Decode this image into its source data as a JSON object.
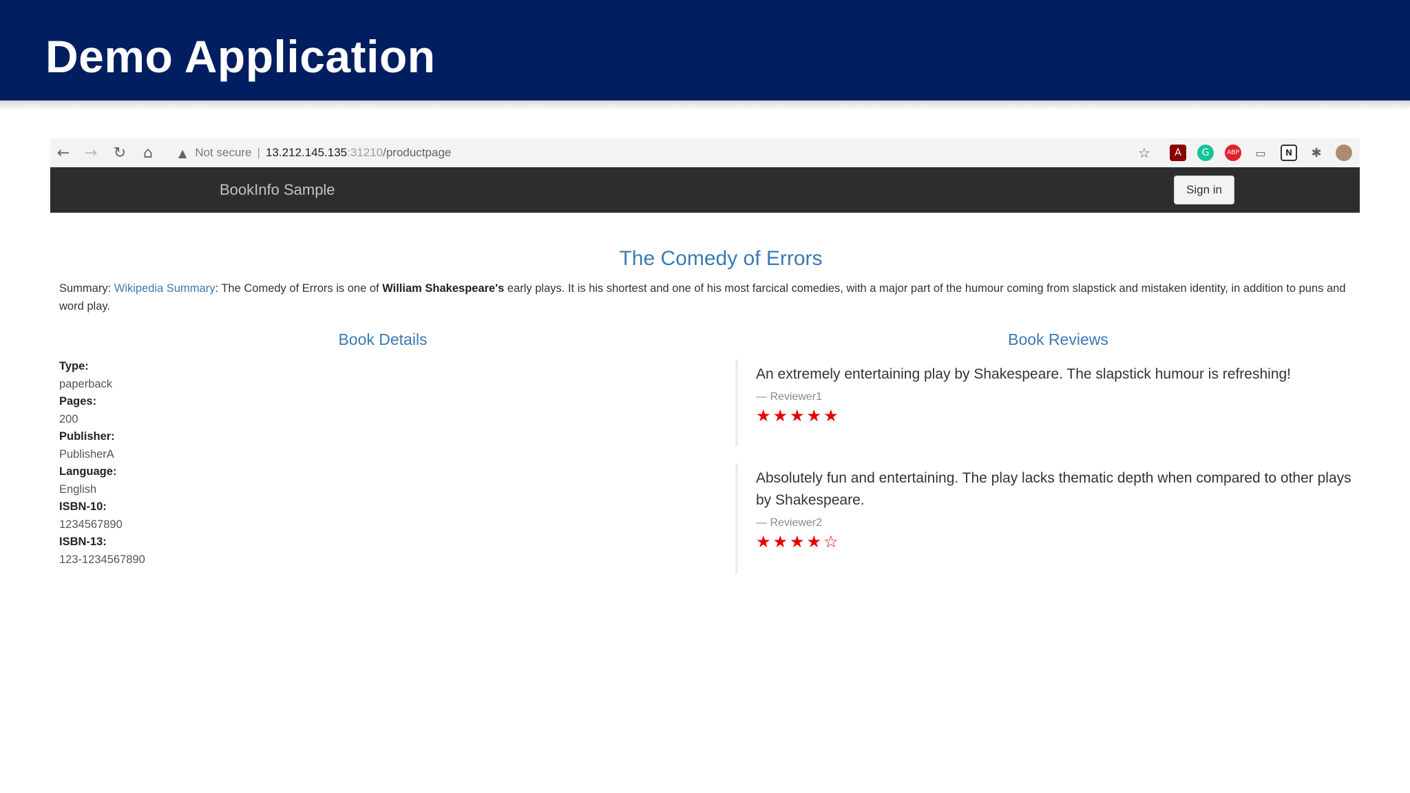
{
  "slide": {
    "title": "Demo Application"
  },
  "browser": {
    "back_icon": "arrow-left-icon",
    "forward_icon": "arrow-right-icon",
    "reload_icon": "reload-icon",
    "home_icon": "home-icon",
    "security_label": "Not secure",
    "separator": "|",
    "url_host": "13.212.145.135",
    "url_port": ":31210",
    "url_path": "/productpage",
    "extensions": [
      "bookmark-star-icon",
      "pdf-icon",
      "grammarly-icon",
      "adblock-icon",
      "cast-icon",
      "notion-icon",
      "puzzle-extensions-icon",
      "profile-avatar-icon"
    ]
  },
  "app": {
    "brand": "BookInfo Sample",
    "sign_in": "Sign in"
  },
  "product": {
    "title": "The Comedy of Errors",
    "summary_prefix": "Summary: ",
    "summary_link": "Wikipedia Summary",
    "summary_text_1": ": The Comedy of Errors is one of ",
    "summary_bold": "William Shakespeare's",
    "summary_text_2": " early plays. It is his shortest and one of his most farcical comedies, with a major part of the humour coming from slapstick and mistaken identity, in addition to puns and word play."
  },
  "details": {
    "heading": "Book Details",
    "items": [
      {
        "label": "Type:",
        "value": "paperback"
      },
      {
        "label": "Pages:",
        "value": "200"
      },
      {
        "label": "Publisher:",
        "value": "PublisherA"
      },
      {
        "label": "Language:",
        "value": "English"
      },
      {
        "label": "ISBN-10:",
        "value": "1234567890"
      },
      {
        "label": "ISBN-13:",
        "value": "123-1234567890"
      }
    ]
  },
  "reviews": {
    "heading": "Book Reviews",
    "items": [
      {
        "text": "An extremely entertaining play by Shakespeare. The slapstick humour is refreshing!",
        "reviewer": "— Reviewer1",
        "rating": 5,
        "stars": "★★★★★"
      },
      {
        "text": "Absolutely fun and entertaining. The play lacks thematic depth when compared to other plays by Shakespeare.",
        "reviewer": "— Reviewer2",
        "rating": 4,
        "stars": "★★★★☆"
      }
    ],
    "star_color": "#e80000"
  }
}
